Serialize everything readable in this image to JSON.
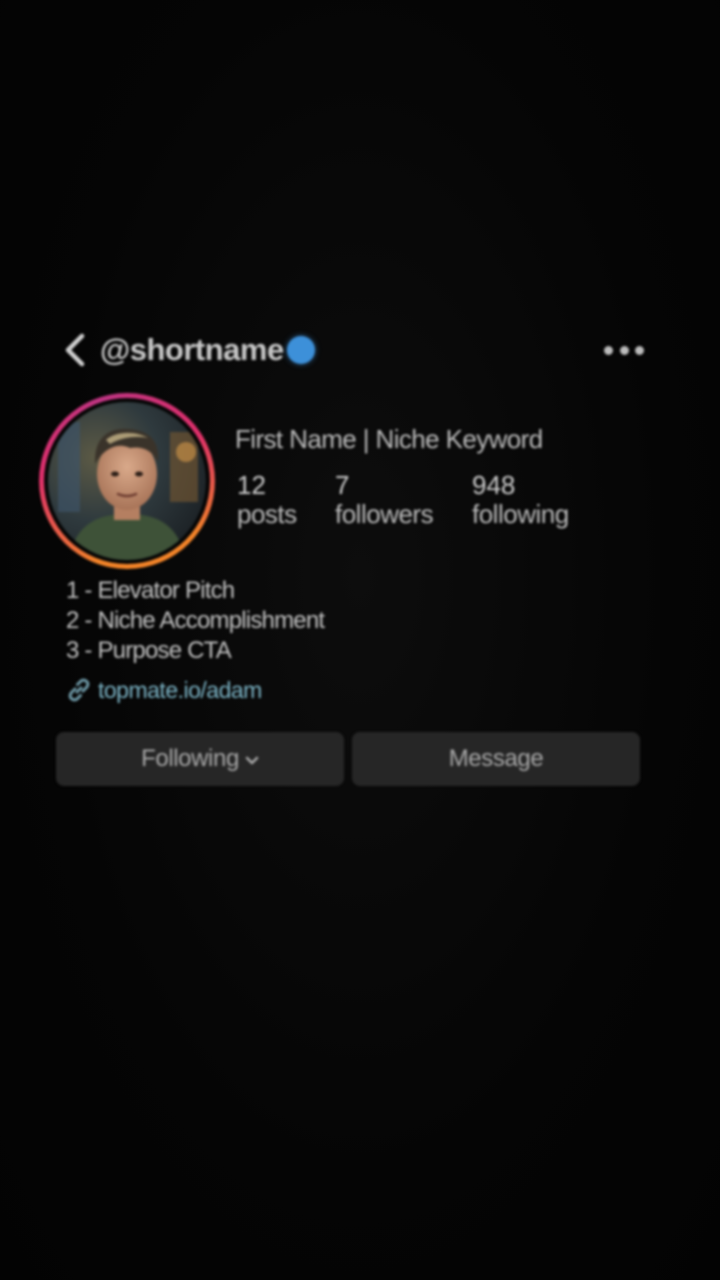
{
  "header": {
    "username": "@shortname",
    "back_icon": "chevron-left-icon",
    "verified_icon": "verified-badge-icon",
    "more_icon": "more-horizontal-icon"
  },
  "profile": {
    "display_name": "First Name | Niche Keyword",
    "stats": {
      "posts": {
        "count": "12",
        "label": "posts"
      },
      "followers": {
        "count": "7",
        "label": "followers"
      },
      "following": {
        "count": "948",
        "label": "following"
      }
    },
    "bio": [
      "1 - Elevator Pitch",
      "2 - Niche Accomplishment",
      "3 - Purpose CTA"
    ],
    "link": "topmate.io/adam",
    "link_icon": "link-icon"
  },
  "actions": {
    "following_label": "Following",
    "message_label": "Message",
    "dropdown_icon": "chevron-down-icon"
  },
  "colors": {
    "background": "#050505",
    "verified": "#3d90d9",
    "link": "#7eb7c9",
    "button_bg": "#262626",
    "story_ring_start": "#f58529",
    "story_ring_end": "#c13584"
  }
}
